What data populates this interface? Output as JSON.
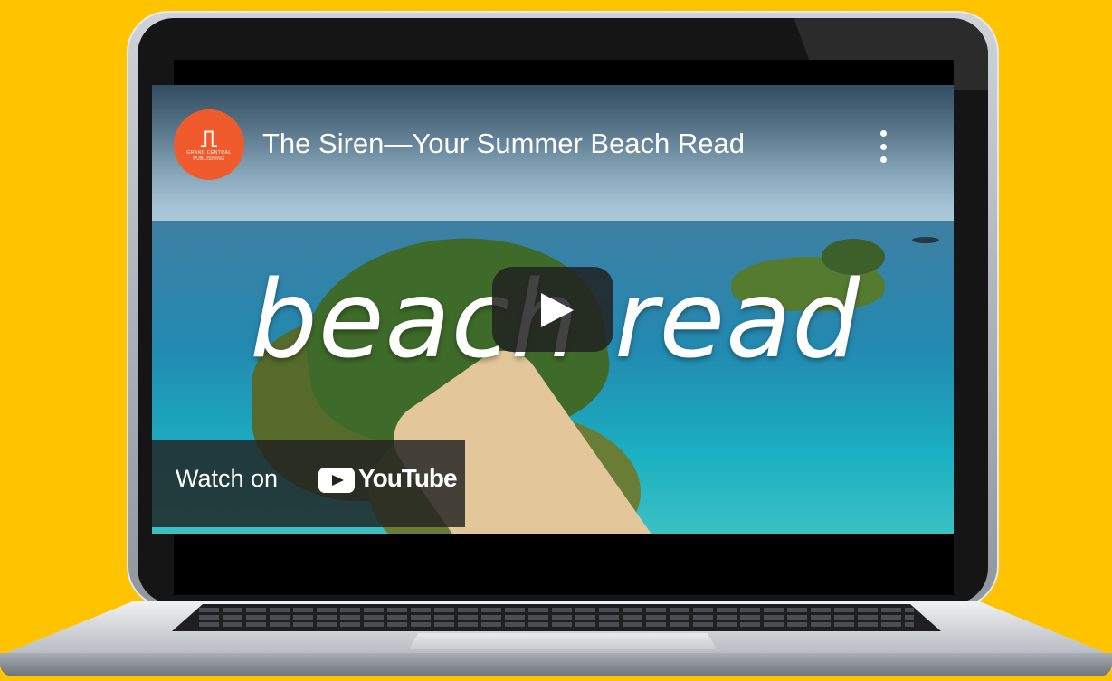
{
  "video": {
    "title": "The Siren—Your Summer Beach Read",
    "overlay_text": "beach read",
    "channel_logo_text_top": "GRAND CENTRAL",
    "channel_logo_text_bottom": "PUBLISHING",
    "watch_on_label": "Watch on",
    "youtube_wordmark": "YouTube"
  },
  "colors": {
    "background": "#ffc300",
    "channel_logo": "#ef5b2c"
  },
  "icons": [
    "more-vert-icon",
    "play-icon",
    "youtube-logo-icon"
  ]
}
